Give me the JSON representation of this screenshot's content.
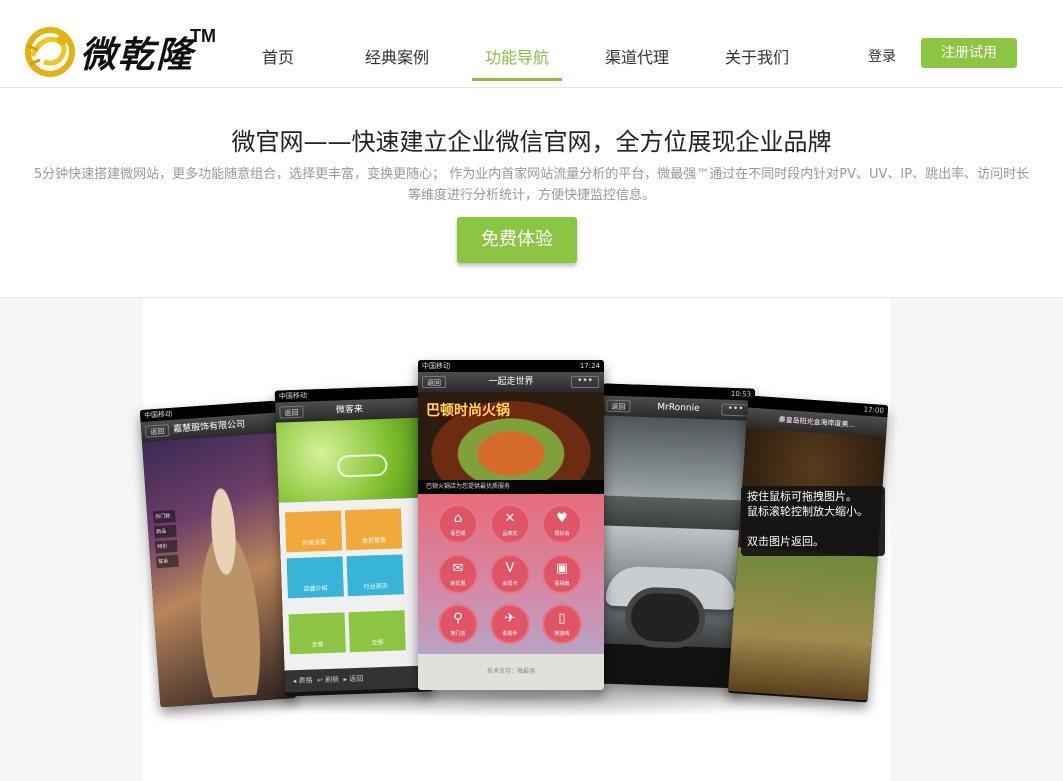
{
  "brand": {
    "name": "微乾隆",
    "trademark": "TM",
    "accent": "#8cc541"
  },
  "nav": {
    "items": [
      {
        "label": "首页"
      },
      {
        "label": "经典案例"
      },
      {
        "label": "功能导航"
      },
      {
        "label": "渠道代理"
      },
      {
        "label": "关于我们"
      }
    ],
    "active": "功能导航",
    "login": "登录",
    "register": "注册试用"
  },
  "hero": {
    "title": "微官网——快速建立企业微信官网，全方位展现企业品牌",
    "description": "5分钟快速搭建微网站，更多功能随意组合，选择更丰富，变换更随心； 作为业内首家网站流量分析的平台，微最强™通过在不同时段内针对PV、UV、IP、跳出率、访问时长等维度进行分析统计，方便快捷监控信息。",
    "cta": "免费体验"
  },
  "showcase": {
    "phone1": {
      "status": "中国移动",
      "back": "返回",
      "title": "嘉慧服饰有限公司",
      "menu": [
        "热门款",
        "新品",
        "特价",
        "联系"
      ]
    },
    "phone2": {
      "status": "中国移动",
      "back": "返回",
      "title": "微客来",
      "tiles": [
        "外卖点菜",
        "会员管理",
        "店面介绍",
        "行业资讯",
        "全部",
        "全部"
      ],
      "footer": [
        "◂ 表格",
        "↩ 刷新",
        "▸ 返回"
      ]
    },
    "phone3": {
      "status": "中国移动",
      "time": "17:24",
      "back": "返回",
      "title": "一起走世界",
      "more": "•••",
      "food_title": "巴顿时尚火锅",
      "caption": "巴顿火锅店为您提供最优质服务",
      "icons": [
        {
          "glyph": "⌂",
          "label": "看巴顿"
        },
        {
          "glyph": "✕",
          "label": "品菜式"
        },
        {
          "glyph": "♥",
          "label": "赞好会"
        },
        {
          "glyph": "✉",
          "label": "新优惠"
        },
        {
          "glyph": "V",
          "label": "会员卡"
        },
        {
          "glyph": "▣",
          "label": "看相册"
        },
        {
          "glyph": "⚲",
          "label": "到门店"
        },
        {
          "glyph": "✈",
          "label": "看助手"
        },
        {
          "glyph": "▯",
          "label": "微游戏"
        }
      ],
      "footer": "技术支持：微最强"
    },
    "phone4": {
      "time": "10:53",
      "back": "返回",
      "title": "MrRonnie",
      "more": "•••"
    },
    "phone5": {
      "time": "17:00",
      "title": "秦皇岛阳光金海岸度美..."
    },
    "tooltip": [
      "按住鼠标可拖拽图片。",
      "鼠标滚轮控制放大缩小。",
      "",
      "双击图片返回。"
    ]
  }
}
